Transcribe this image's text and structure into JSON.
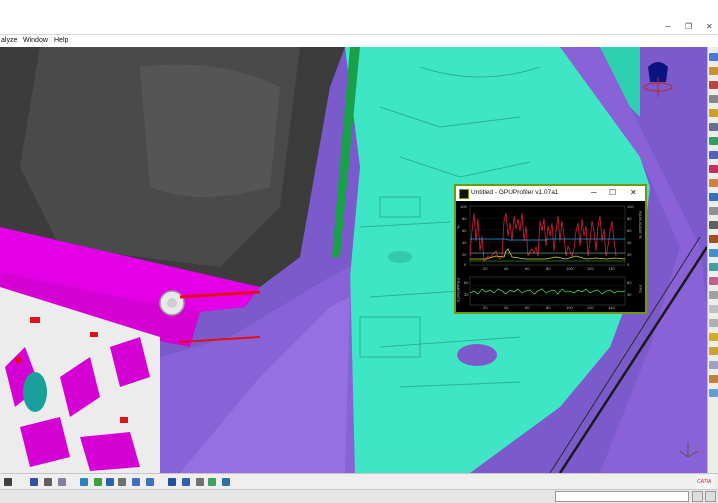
{
  "window": {
    "controls": {
      "minimize": "─",
      "restore": "❐",
      "close": "✕"
    }
  },
  "menu": {
    "items": [
      {
        "label": "alyze"
      },
      {
        "label": "Window"
      },
      {
        "label": "Help"
      }
    ]
  },
  "gpu_profiler": {
    "title": "Untitled - GPUProfiler v1.07a1",
    "buttons": {
      "minimize": "─",
      "maximize": "☐",
      "close": "✕"
    },
    "top_chart": {
      "x_ticks": [
        "20",
        "40",
        "60",
        "80",
        "100",
        "120",
        "140"
      ],
      "y_ticks_left": [
        "100",
        "80",
        "60",
        "40",
        "20",
        "0"
      ],
      "y_ticks_right": [
        "100",
        "80",
        "60",
        "40",
        "20",
        "0"
      ],
      "left_axis_label": "%",
      "right_axis_label": "RAMUSAGE %"
    },
    "bottom_chart": {
      "x_ticks": [
        "20",
        "40",
        "60",
        "80",
        "100",
        "120",
        "140"
      ],
      "y_ticks_left": [
        "60",
        "30"
      ],
      "y_ticks_right": [
        "60",
        "30"
      ],
      "left_axis_label": "FRAMERATE",
      "right_axis_label": "FPS"
    }
  },
  "catia_logo": "CATIA",
  "colors": {
    "magenta": "#e300e6",
    "cyan_body": "#3fe6c6",
    "purple_body": "#8a62d8",
    "gpu_border": "#6f9a10",
    "gpu_line_red": "#d21e3e",
    "gpu_line_yellow": "#d8d820",
    "gpu_line_green": "#40d040",
    "gpu_line_blue": "#2aa6f0"
  },
  "icons": {
    "right_toolbar": [
      "sketch-icon",
      "plane-icon",
      "pad-icon",
      "pocket-icon",
      "shaft-icon",
      "groove-icon",
      "hole-icon",
      "rib-icon",
      "slot-icon",
      "stiffener-icon",
      "loft-icon",
      "edge-fillet-icon",
      "chamfer-icon",
      "draft-icon",
      "shell-icon",
      "thickness-icon",
      "thread-icon",
      "translate-icon",
      "rotate-icon",
      "mirror-icon",
      "pattern-icon",
      "scale-icon",
      "boolean-icon",
      "measure-icon",
      "apply-material-icon"
    ],
    "bottom_toolbar": [
      "select-icon",
      "fit-all-icon",
      "pan-icon",
      "rotate-view-icon",
      "zoom-in-icon",
      "zoom-out-icon",
      "normal-view-icon",
      "iso-view-icon",
      "render-style-icon",
      "hide-show-icon",
      "swap-visible-icon",
      "shading-icon",
      "perspective-icon",
      "analysis-icon",
      "update-icon",
      "compass-icon"
    ]
  }
}
